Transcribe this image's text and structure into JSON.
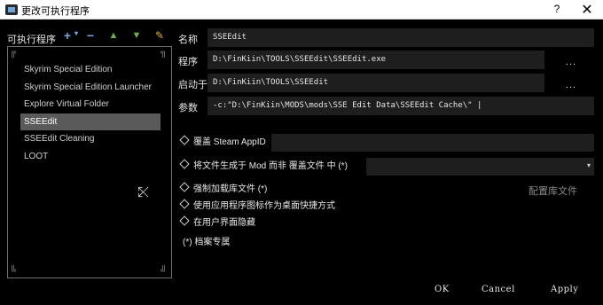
{
  "window": {
    "title": "更改可执行程序",
    "help": "?",
    "close": "✕"
  },
  "toolbar": {
    "label": "可执行程序",
    "add_icon": "+",
    "add_small": "▾",
    "remove_icon": "−",
    "up_icon": "▲",
    "down_icon": "▼",
    "clean_icon": "✎"
  },
  "executables": [
    {
      "label": "Skyrim Special Edition",
      "selected": false
    },
    {
      "label": "Skyrim Special Edition Launcher",
      "selected": false
    },
    {
      "label": "Explore Virtual Folder",
      "selected": false
    },
    {
      "label": "SSEEdit",
      "selected": true
    },
    {
      "label": "SSEEdit Cleaning",
      "selected": false
    },
    {
      "label": "LOOT",
      "selected": false
    }
  ],
  "cursor_glyph": "⤪",
  "form": {
    "name_label": "名称",
    "name_value": "SSEEdit",
    "program_label": "程序",
    "program_value": "D:\\FinKiin\\TOOLS\\SSEEdit\\SSEEdit.exe",
    "startin_label": "启动于",
    "startin_value": "D:\\FinKiin\\TOOLS\\SSEEdit",
    "args_label": "参数",
    "args_value": "-c:\"D:\\FinKiin\\MODS\\mods\\SSE Edit Data\\SSEEdit Cache\\\" |",
    "browse": "..."
  },
  "options": {
    "steam": "覆盖 Steam AppID",
    "create_files": "将文件生成于 Mod 而非 覆盖文件 中 (*)",
    "force_load": "强制加载库文件 (*)",
    "use_icon": "使用应用程序图标作为桌面快捷方式",
    "hide": "在用户界面隐藏",
    "note": "(*) 档案专属",
    "config_libs": "配置库文件",
    "dropdown_arrow": "▾"
  },
  "buttons": {
    "ok": "OK",
    "cancel": "Cancel",
    "apply": "Apply"
  }
}
